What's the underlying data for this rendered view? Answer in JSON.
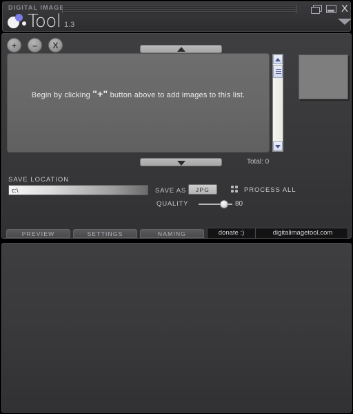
{
  "titlebar": {
    "brand": "DIGITAL IMAGE",
    "app_name": "Tool",
    "version": "1.3",
    "controls": {
      "restore": "restore-icon",
      "minimize": "minimize-icon",
      "close": "X",
      "expand": "chevron-down-icon"
    }
  },
  "toolbar": {
    "add_label": "+",
    "remove_label": "–",
    "clear_label": "X"
  },
  "list": {
    "empty_prefix": "Begin by clicking ",
    "empty_plus": "\"+\"",
    "empty_suffix": " button above  to add images to this list.",
    "total_label": "Total: 0",
    "handle_up": "collapse-up-icon",
    "handle_down": "expand-down-icon"
  },
  "save": {
    "location_label": "SAVE LOCATION",
    "location_value": "c:\\",
    "location_placeholder": "c:\\",
    "save_as_label": "SAVE AS",
    "format_value": "JPG",
    "process_label": "PROCESS ALL",
    "quality_label": "QUALITY",
    "quality_value": "80"
  },
  "tabs": [
    {
      "label": "PREVIEW"
    },
    {
      "label": "SETTINGS"
    },
    {
      "label": "NAMING"
    }
  ],
  "links": {
    "donate": "donate :)",
    "website": "digitalimagetool.com"
  }
}
